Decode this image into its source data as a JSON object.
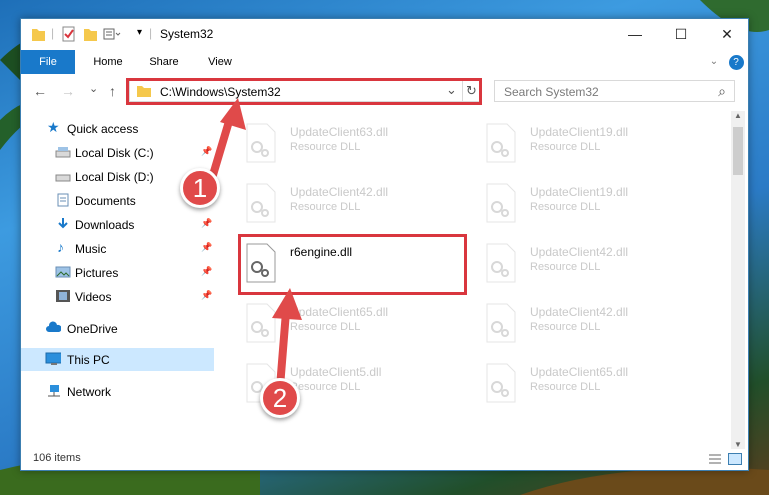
{
  "window": {
    "title": "System32",
    "controls": {
      "minimize": "—",
      "maximize": "☐",
      "close": "✕"
    }
  },
  "ribbon": {
    "tabs": [
      "File",
      "Home",
      "Share",
      "View"
    ],
    "help": "?"
  },
  "address_bar": {
    "path": "C:\\Windows\\System32",
    "refresh_icon": "↻",
    "dropdown_icon": "⌄"
  },
  "search": {
    "placeholder": "Search System32",
    "icon": "⌕"
  },
  "nav_buttons": {
    "back": "←",
    "forward": "→",
    "recent": "⌄",
    "up": "↑"
  },
  "sidebar": {
    "items": [
      {
        "label": "Quick access",
        "icon": "star-icon",
        "pinned": false
      },
      {
        "label": "Local Disk (C:)",
        "icon": "drive-icon",
        "pinned": true
      },
      {
        "label": "Local Disk (D:)",
        "icon": "drive-icon",
        "pinned": true
      },
      {
        "label": "Documents",
        "icon": "documents-icon",
        "pinned": true
      },
      {
        "label": "Downloads",
        "icon": "downloads-icon",
        "pinned": true
      },
      {
        "label": "Music",
        "icon": "music-icon",
        "pinned": true
      },
      {
        "label": "Pictures",
        "icon": "pictures-icon",
        "pinned": true
      },
      {
        "label": "Videos",
        "icon": "videos-icon",
        "pinned": true
      },
      {
        "label": "OneDrive",
        "icon": "cloud-icon",
        "pinned": false
      },
      {
        "label": "This PC",
        "icon": "computer-icon",
        "pinned": false,
        "selected": true
      },
      {
        "label": "Network",
        "icon": "network-icon",
        "pinned": false
      }
    ]
  },
  "files": [
    {
      "name": "UpdateClient63.dll",
      "type": "Resource DLL"
    },
    {
      "name": "UpdateClient19.dll",
      "type": "Resource DLL"
    },
    {
      "name": "UpdateClient42.dll",
      "type": "Resource DLL"
    },
    {
      "name": "UpdateClient19.dll",
      "type": "Resource DLL"
    },
    {
      "name": "r6engine.dll",
      "type": ""
    },
    {
      "name": "UpdateClient42.dll",
      "type": "Resource DLL"
    },
    {
      "name": "UpdateClient65.dll",
      "type": "Resource DLL"
    },
    {
      "name": "UpdateClient42.dll",
      "type": "Resource DLL"
    },
    {
      "name": "UpdateClient5.dll",
      "type": "Resource DLL"
    },
    {
      "name": "UpdateClient65.dll",
      "type": "Resource DLL"
    }
  ],
  "status": {
    "item_count": "106 items"
  },
  "annotations": {
    "step1": "1",
    "step2": "2"
  },
  "colors": {
    "accent": "#1979ca",
    "highlight": "#d9363e",
    "selected": "#cce8ff"
  }
}
